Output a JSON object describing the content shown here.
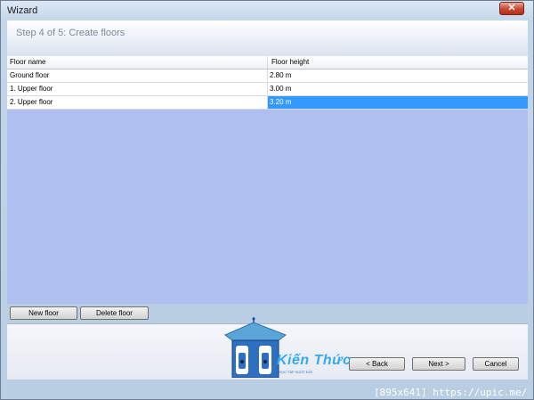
{
  "window": {
    "title": "Wizard",
    "close_glyph": "✕"
  },
  "header": {
    "step_title": "Step 4 of 5:  Create floors"
  },
  "grid": {
    "columns": [
      "Floor name",
      "Floor height"
    ],
    "rows": [
      {
        "name": "Ground floor",
        "height": "2.80 m"
      },
      {
        "name": "1. Upper floor",
        "height": "3.00 m"
      },
      {
        "name": "2. Upper floor",
        "height": "3.20 m"
      }
    ],
    "selected_row": 2
  },
  "buttons": {
    "new_floor": "New floor",
    "delete_floor": "Delete floor",
    "back": "< Back",
    "next": "Next >",
    "cancel": "Cancel"
  },
  "watermark": {
    "logo_text": "Kiến Thức",
    "logo_sub": "HỌC TẬP SUỐT ĐỜI"
  },
  "status_bar": {
    "text": "[895x641] https://upic.me/"
  },
  "colors": {
    "selection": "#3399ff",
    "content_bg": "#aebff0",
    "accent": "#37a9f0"
  }
}
